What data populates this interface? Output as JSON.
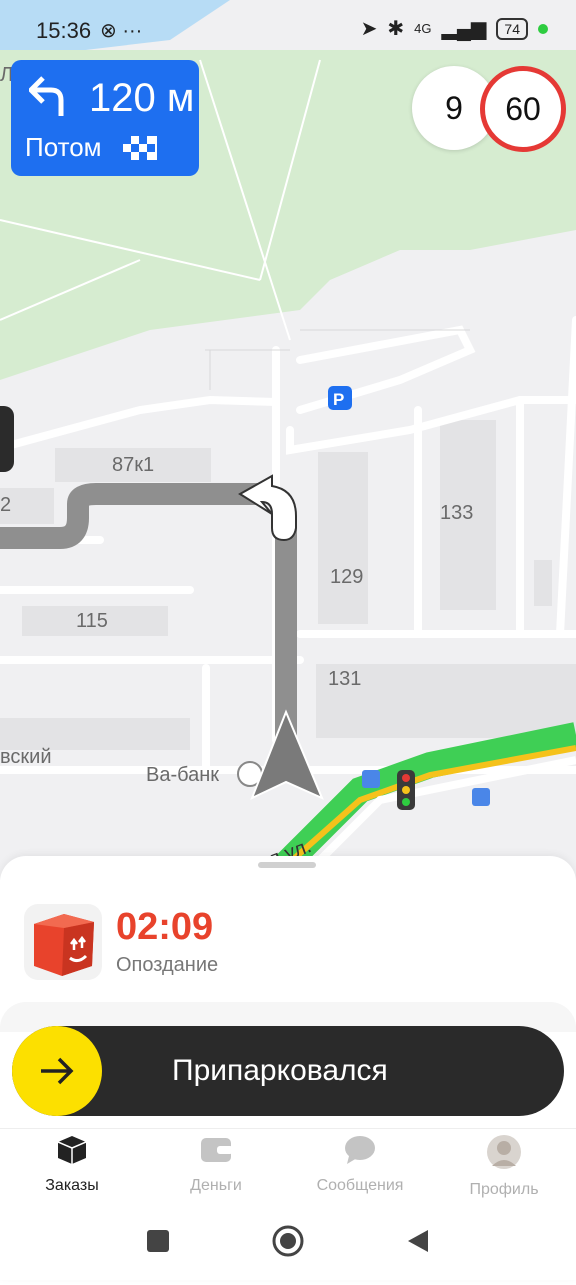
{
  "status_bar": {
    "time": "15:36",
    "left_icons": "⊗ ···",
    "battery": "74",
    "network": "4G"
  },
  "maneuver": {
    "distance": "120 м",
    "then_label": "Потом"
  },
  "speed": {
    "current": "9",
    "limit": "60"
  },
  "map_labels": {
    "building_87k1": "87к1",
    "building_133": "133",
    "building_129": "129",
    "building_115": "115",
    "building_131": "131",
    "street_partial": "вский",
    "shop": "Ва-банк",
    "street_bottom": "л ул.",
    "edge_2": "2",
    "edge_top": "Л"
  },
  "order": {
    "timer": "02:09",
    "status": "Опоздание"
  },
  "action": {
    "label": "Припарковался"
  },
  "tabs": [
    {
      "label": "Заказы",
      "icon": "box-icon"
    },
    {
      "label": "Деньги",
      "icon": "wallet-icon"
    },
    {
      "label": "Сообщения",
      "icon": "chat-icon"
    },
    {
      "label": "Профиль",
      "icon": "avatar"
    }
  ],
  "colors": {
    "maneuver_bg": "#1e6ff0",
    "timer": "#e8432c",
    "action_accent": "#fce000",
    "speed_limit_ring": "#e53935",
    "route": "#8f8f8f"
  }
}
